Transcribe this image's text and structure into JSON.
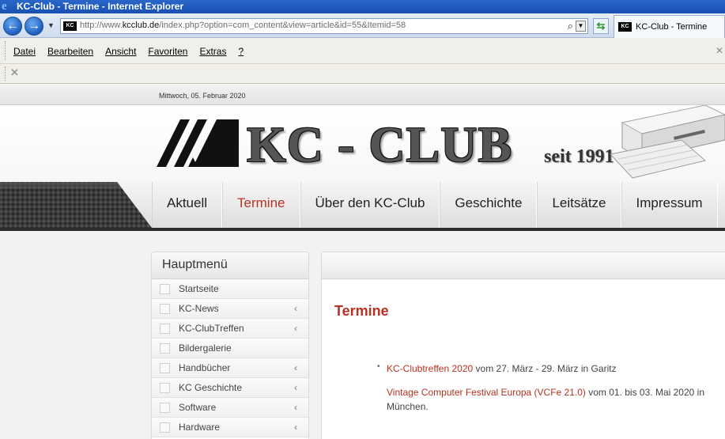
{
  "browser": {
    "window_title": "KC-Club - Termine - Internet Explorer",
    "url_prefix": "http://www.",
    "url_domain": "kcclub.de",
    "url_rest": "/index.php?option=com_content&view=article&id=55&Itemid=58",
    "tab_label": "KC-Club - Termine",
    "menu": [
      "Datei",
      "Bearbeiten",
      "Ansicht",
      "Favoriten",
      "Extras",
      "?"
    ],
    "favicon_text": "KC"
  },
  "site": {
    "date": "Mittwoch, 05. Februar 2020",
    "logo_text": "KC - CLUB",
    "logo_sub": "seit 1991",
    "nav": [
      "Aktuell",
      "Termine",
      "Über den KC-Club",
      "Geschichte",
      "Leitsätze",
      "Impressum"
    ],
    "active_nav": "Termine"
  },
  "sidebar": {
    "title": "Hauptmenü",
    "items": [
      {
        "label": "Startseite",
        "chevron": ""
      },
      {
        "label": "KC-News",
        "chevron": "‹"
      },
      {
        "label": "KC-ClubTreffen",
        "chevron": "‹"
      },
      {
        "label": "Bildergalerie",
        "chevron": ""
      },
      {
        "label": "Handbücher",
        "chevron": "‹"
      },
      {
        "label": "KC Geschichte",
        "chevron": "‹"
      },
      {
        "label": "Software",
        "chevron": "‹"
      },
      {
        "label": "Hardware",
        "chevron": "‹"
      }
    ]
  },
  "content": {
    "title": "Termine",
    "entries": [
      {
        "link": "KC-Clubtreffen 2020",
        "text": " vom 27. März - 29. März in Garitz"
      },
      {
        "link": "Vintage Computer Festival Europa (VCFe 21.0)",
        "text": " vom 01. bis 03. Mai 2020 in München."
      }
    ]
  },
  "colors": {
    "accent": "#b83224",
    "titlebar": "#1f5cc0"
  }
}
